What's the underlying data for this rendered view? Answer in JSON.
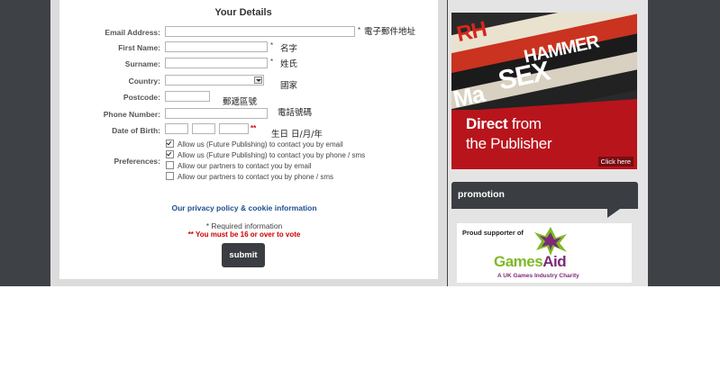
{
  "form": {
    "title": "Your Details",
    "fields": {
      "email": {
        "label": "Email Address:",
        "required_mark": "*",
        "cjk": "電子郵件地址",
        "value": ""
      },
      "first_name": {
        "label": "First Name:",
        "required_mark": "*",
        "cjk": "名字",
        "value": ""
      },
      "surname": {
        "label": "Surname:",
        "required_mark": "*",
        "cjk": "姓氏",
        "value": ""
      },
      "country": {
        "label": "Country:",
        "cjk": "國家",
        "selected": ""
      },
      "postcode": {
        "label": "Postcode:",
        "cjk": "郵遞區號",
        "value": ""
      },
      "phone": {
        "label": "Phone Number:",
        "cjk": "電話號碼",
        "value": ""
      },
      "dob": {
        "label": "Date of Birth:",
        "required_mark": "**",
        "cjk": "生日 日/月/年",
        "day": "",
        "month": "",
        "year": ""
      }
    },
    "preferences": {
      "label": "Preferences:",
      "options": [
        {
          "text": "Allow us (Future Publishing) to contact you by email",
          "checked": true
        },
        {
          "text": "Allow us (Future Publishing) to contact you by phone / sms",
          "checked": true
        },
        {
          "text": "Allow our partners to contact you by email",
          "checked": false
        },
        {
          "text": "Allow our partners to contact you by phone / sms",
          "checked": false
        }
      ]
    },
    "privacy_link": "Our privacy policy & cookie information",
    "required_note": "* Required information",
    "age_note": "** You must be 16 or over to vote",
    "submit_label": "submit"
  },
  "sidebar": {
    "ad": {
      "line1_bold": "Direct",
      "line1_rest": " from",
      "line2": "the Publisher",
      "click": "Click here",
      "magazines": [
        "RH",
        "SEX",
        "HAMMER",
        "Ma"
      ]
    },
    "promotion": {
      "title": "promotion",
      "supporter": "Proud supporter of",
      "brand_g": "Games",
      "brand_rest": "Aid",
      "tagline": "A UK Games Industry Charity"
    }
  },
  "colors": {
    "header_dark": "#3e4246",
    "accent_red": "#b8141c",
    "link_blue": "#1f4f8f",
    "gamesaid_purple": "#7b2a78",
    "gamesaid_green": "#7fb928"
  }
}
